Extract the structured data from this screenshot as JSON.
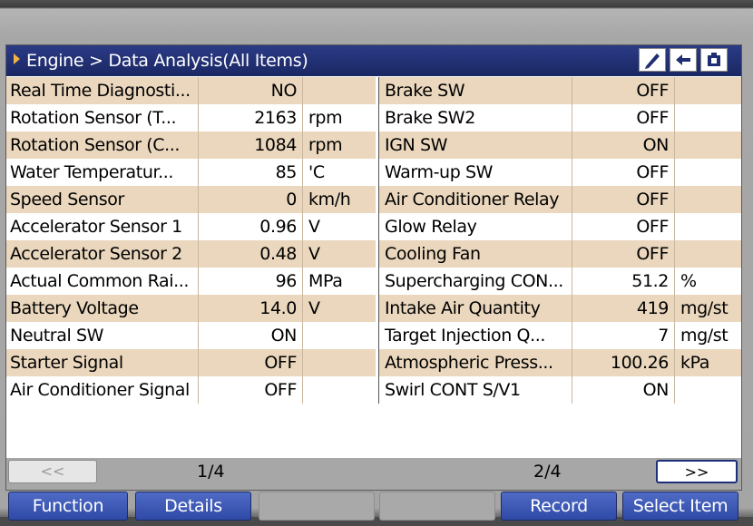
{
  "header": {
    "title": "Engine > Data Analysis(All Items)"
  },
  "icons": {
    "pen": "pen-icon",
    "back": "back-arrow-icon",
    "home": "home-icon",
    "title_marker": "triangle-right-icon"
  },
  "colors": {
    "title_bar": "#1f2e73",
    "row_stripe": "#ead7bd",
    "marker": "#f2b441",
    "function_button": "#3f5bb8"
  },
  "table": {
    "left": [
      {
        "name": "Real Time Diagnosti...",
        "value": "NO",
        "unit": ""
      },
      {
        "name": "Rotation Sensor (T...",
        "value": "2163",
        "unit": "rpm"
      },
      {
        "name": "Rotation Sensor (C...",
        "value": "1084",
        "unit": "rpm"
      },
      {
        "name": "Water Temperatur...",
        "value": "85",
        "unit": "'C"
      },
      {
        "name": "Speed Sensor",
        "value": "0",
        "unit": "km/h"
      },
      {
        "name": "Accelerator Sensor 1",
        "value": "0.96",
        "unit": "V"
      },
      {
        "name": "Accelerator Sensor 2",
        "value": "0.48",
        "unit": "V"
      },
      {
        "name": "Actual Common Rai...",
        "value": "96",
        "unit": "MPa"
      },
      {
        "name": "Battery Voltage",
        "value": "14.0",
        "unit": "V"
      },
      {
        "name": "Neutral SW",
        "value": "ON",
        "unit": ""
      },
      {
        "name": "Starter Signal",
        "value": "OFF",
        "unit": ""
      },
      {
        "name": "Air Conditioner Signal",
        "value": "OFF",
        "unit": ""
      }
    ],
    "right": [
      {
        "name": "Brake SW",
        "value": "OFF",
        "unit": ""
      },
      {
        "name": "Brake SW2",
        "value": "OFF",
        "unit": ""
      },
      {
        "name": "IGN SW",
        "value": "ON",
        "unit": ""
      },
      {
        "name": "Warm-up SW",
        "value": "OFF",
        "unit": ""
      },
      {
        "name": "Air Conditioner Relay",
        "value": "OFF",
        "unit": ""
      },
      {
        "name": "Glow Relay",
        "value": "OFF",
        "unit": ""
      },
      {
        "name": "Cooling Fan",
        "value": "OFF",
        "unit": ""
      },
      {
        "name": "Supercharging CON...",
        "value": "51.2",
        "unit": "%"
      },
      {
        "name": "Intake Air Quantity",
        "value": "419",
        "unit": "mg/st"
      },
      {
        "name": "Target Injection Q...",
        "value": "7",
        "unit": "mg/st"
      },
      {
        "name": "Atmospheric Press...",
        "value": "100.26",
        "unit": "kPa"
      },
      {
        "name": "Swirl CONT S/V1",
        "value": "ON",
        "unit": ""
      }
    ]
  },
  "pager": {
    "prev_label": "<<",
    "left_page": "1/4",
    "right_page": "2/4",
    "next_label": ">>"
  },
  "function_bar": {
    "function_label": "Function",
    "details_label": "Details",
    "blank1_label": "",
    "blank2_label": "",
    "record_label": "Record",
    "select_item_label": "Select Item"
  }
}
